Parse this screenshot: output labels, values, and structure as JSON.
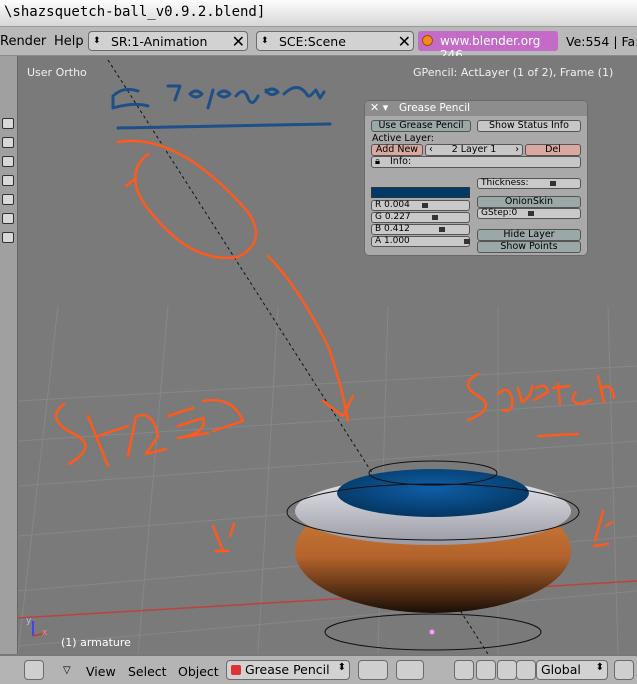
{
  "window": {
    "title": "\\shazsquetch-ball_v0.9.2.blend]"
  },
  "menubar": {
    "items": [
      "Render",
      "Help"
    ],
    "screen_selector": "SR:1-Animation",
    "scene_selector": "SCE:Scene",
    "web_link": "www.blender.org 246",
    "stats": "Ve:554 | Fa:"
  },
  "viewport": {
    "view_label": "User Ortho",
    "gpencil_info": "GPencil: ActLayer (1 of 2), Frame (1)",
    "object_label": "(1) armature",
    "axis_x": "x",
    "axis_y": "y",
    "annotations": [
      "3d poder",
      "Shaz",
      "Squetch"
    ]
  },
  "grease_pencil_panel": {
    "title": "Grease Pencil",
    "use_grease_pencil": "Use Grease Pencil",
    "show_status_info": "Show Status Info",
    "active_layer_label": "Active Layer:",
    "add_new": "Add New",
    "layer_name": "2 Layer 1",
    "del": "Del",
    "info": "Info:",
    "color": {
      "r": "R 0.004",
      "g": "G 0.227",
      "b": "B 0.412",
      "a": "A 1.000",
      "r_val": 0.004,
      "g_val": 0.227,
      "b_val": 0.412,
      "a_val": 1.0,
      "swatch": "#013969"
    },
    "thickness": "Thickness:",
    "onion_skin": "OnionSkin",
    "gstep": "GStep:0",
    "hide_layer": "Hide Layer",
    "show_points": "Show Points"
  },
  "bottombar": {
    "view": "View",
    "select": "Select",
    "object": "Object",
    "mode": "Grease Pencil",
    "orientation": "Global"
  },
  "colors": {
    "stroke": "#ff5a1c",
    "blue_stroke": "#1e4f86",
    "ball_orange": "#c8753a"
  }
}
